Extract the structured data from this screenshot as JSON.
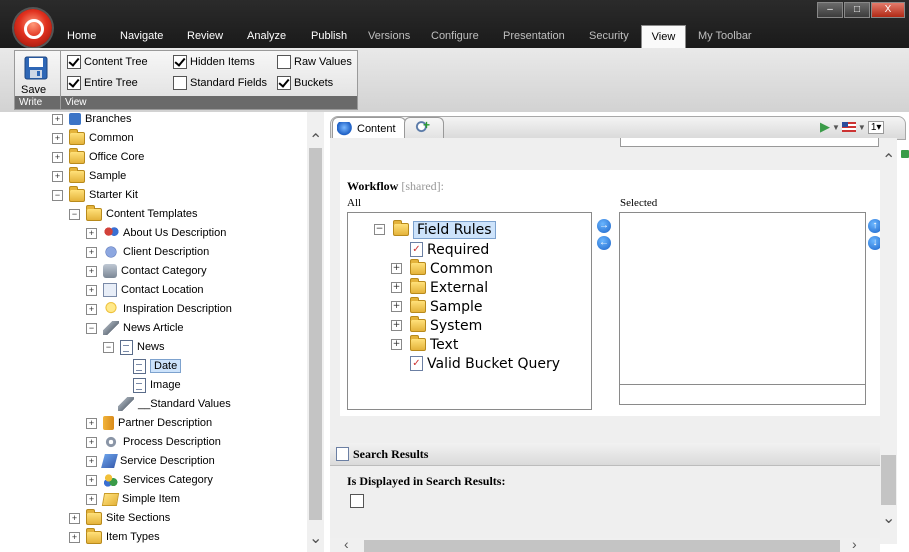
{
  "ribbon": {
    "tabs": [
      {
        "label": "Home"
      },
      {
        "label": "Navigate"
      },
      {
        "label": "Review"
      },
      {
        "label": "Analyze"
      },
      {
        "label": "Publish"
      },
      {
        "label": "Versions"
      },
      {
        "label": "Configure"
      },
      {
        "label": "Presentation"
      },
      {
        "label": "Security"
      },
      {
        "label": "View"
      },
      {
        "label": "My Toolbar"
      }
    ],
    "active_tab": "View",
    "write_group": {
      "save_label": "Save",
      "group_label": "Write"
    },
    "view_group": {
      "group_label": "View",
      "checkboxes": [
        {
          "label": "Content Tree",
          "checked": true
        },
        {
          "label": "Hidden Items",
          "checked": true
        },
        {
          "label": "Raw Values",
          "checked": false
        },
        {
          "label": "Entire Tree",
          "checked": true
        },
        {
          "label": "Standard Fields",
          "checked": false
        },
        {
          "label": "Buckets",
          "checked": true
        }
      ]
    }
  },
  "tree": {
    "items": [
      {
        "label": "Branches"
      },
      {
        "label": "Common"
      },
      {
        "label": "Office Core"
      },
      {
        "label": "Sample"
      },
      {
        "label": "Starter Kit"
      },
      {
        "label": "Content Templates"
      },
      {
        "label": "About Us Description"
      },
      {
        "label": "Client Description"
      },
      {
        "label": "Contact Category"
      },
      {
        "label": "Contact Location"
      },
      {
        "label": "Inspiration Description"
      },
      {
        "label": "News Article"
      },
      {
        "label": "News"
      },
      {
        "label": "Date"
      },
      {
        "label": "Image"
      },
      {
        "label": "__Standard Values"
      },
      {
        "label": "Partner Description"
      },
      {
        "label": "Process Description"
      },
      {
        "label": "Service Description"
      },
      {
        "label": "Services Category"
      },
      {
        "label": "Simple Item"
      },
      {
        "label": "Site Sections"
      },
      {
        "label": "Item Types"
      }
    ],
    "selected": "Date"
  },
  "editor": {
    "tab_content": "Content",
    "workflow": {
      "label": "Workflow",
      "shared": "[shared]:",
      "all_label": "All",
      "selected_label": "Selected",
      "items": [
        {
          "label": "Field Rules"
        },
        {
          "label": "Required"
        },
        {
          "label": "Common"
        },
        {
          "label": "External"
        },
        {
          "label": "Sample"
        },
        {
          "label": "System"
        },
        {
          "label": "Text"
        },
        {
          "label": "Valid Bucket Query"
        }
      ]
    },
    "search_results": {
      "section_title": "Search Results",
      "field_label": "Is Displayed in Search Results:"
    },
    "language": "1"
  }
}
